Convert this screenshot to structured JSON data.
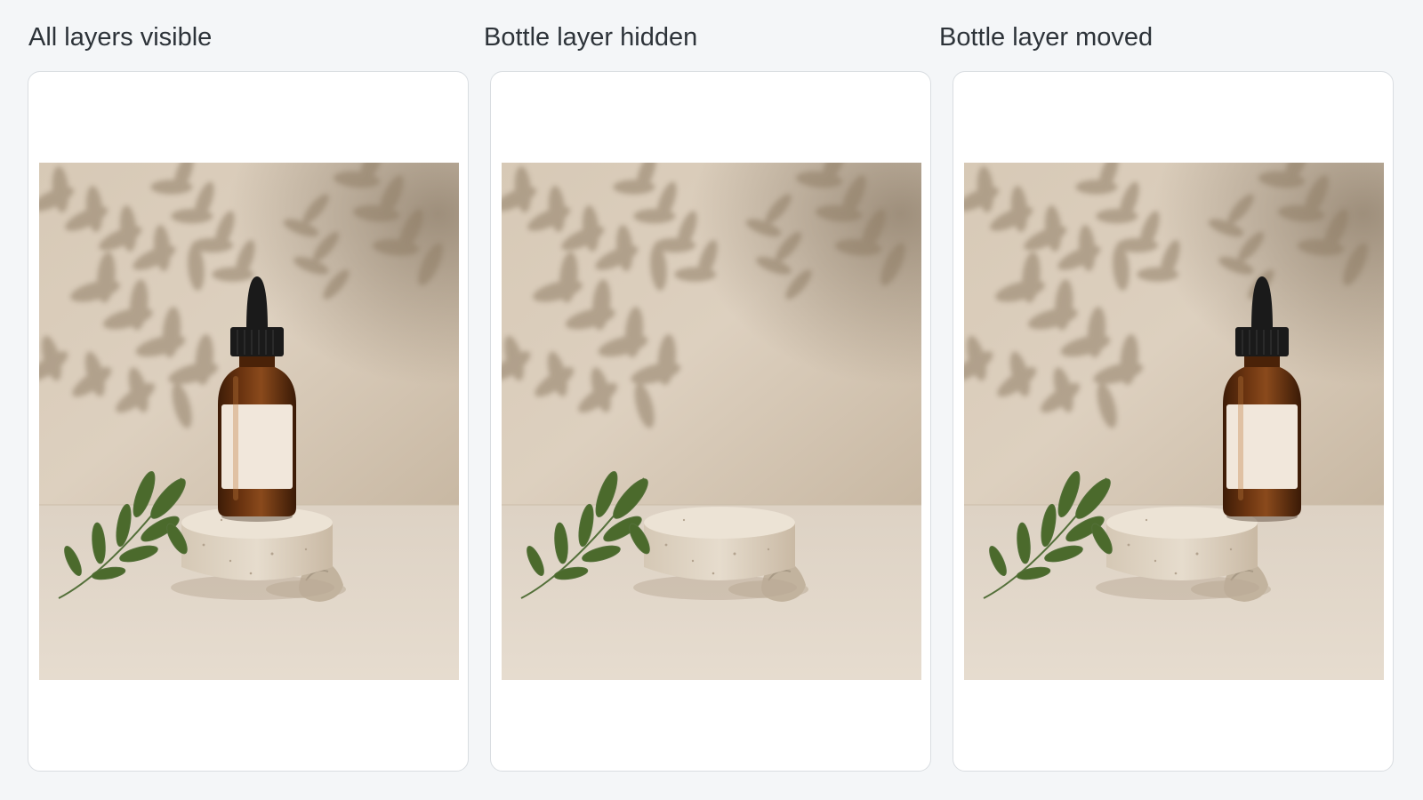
{
  "panels": [
    {
      "title": "All layers visible",
      "bottle_visible": true,
      "bottle_position": "on-pedestal"
    },
    {
      "title": "Bottle layer hidden",
      "bottle_visible": false,
      "bottle_position": "none"
    },
    {
      "title": "Bottle layer moved",
      "bottle_visible": true,
      "bottle_position": "right"
    }
  ],
  "colors": {
    "page_background": "#f4f6f8",
    "card_background": "#ffffff",
    "card_border": "#d9dde1",
    "title_text": "#2d3339",
    "wall": "#ddd0bf",
    "floor": "#e6dccf",
    "bottle_glass": "#6b3410",
    "bottle_cap": "#1a1a1a",
    "bottle_label": "#f1e7db",
    "leaf": "#4b6a2c"
  }
}
